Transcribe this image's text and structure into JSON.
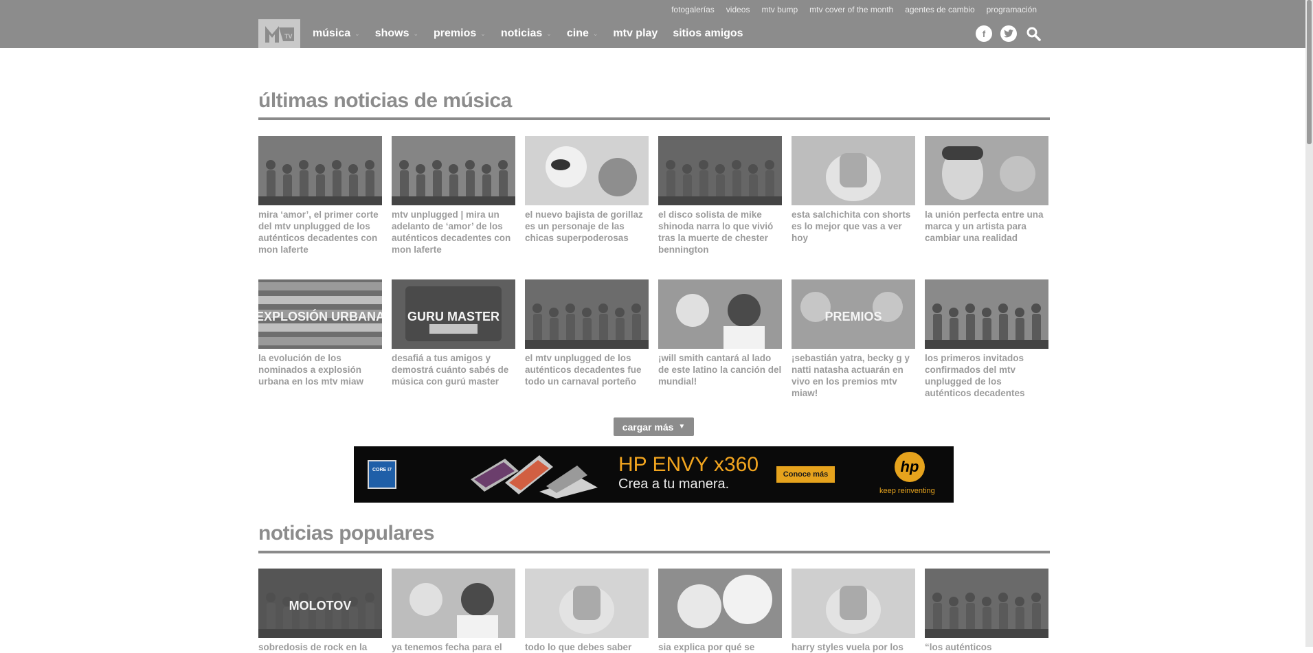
{
  "top_links": [
    "fotogalerías",
    "videos",
    "mtv bump",
    "mtv cover of the month",
    "agentes de cambio",
    "programación"
  ],
  "nav": [
    {
      "label": "música",
      "dropdown": true
    },
    {
      "label": "shows",
      "dropdown": true
    },
    {
      "label": "premios",
      "dropdown": true
    },
    {
      "label": "noticias",
      "dropdown": true
    },
    {
      "label": "cine",
      "dropdown": true
    },
    {
      "label": "mtv play",
      "dropdown": false
    },
    {
      "label": "sitios amigos",
      "dropdown": false
    }
  ],
  "social": {
    "facebook": "f"
  },
  "latest": {
    "title": "últimas noticias de música",
    "items": [
      {
        "caption": "mira ‘amor’, el primer corte del mtv unplugged de los auténticos decadentes con mon laferte",
        "thumb": "concert",
        "tone": "#7a7a7a"
      },
      {
        "caption": "mtv unplugged | mira un adelanto de ‘amor’ de los auténticos decadentes con mon laferte",
        "thumb": "concert",
        "tone": "#858585"
      },
      {
        "caption": "el nuevo bajista de gorillaz es un personaje de las chicas superpoderosas",
        "thumb": "cartoon",
        "tone": "#d2d2d2"
      },
      {
        "caption": "el disco solista de mike shinoda narra lo que vivió tras la muerte de chester bennington",
        "thumb": "stage",
        "tone": "#666666"
      },
      {
        "caption": "esta salchichita con shorts es lo mejor que vas a ver hoy",
        "thumb": "light",
        "tone": "#bdbdbd"
      },
      {
        "caption": "la unión perfecta entre una marca y un artista para cambiar una realidad",
        "thumb": "portrait",
        "tone": "#a8a8a8"
      },
      {
        "caption": "la evolución de los nominados a explosión urbana en los mtv miaw",
        "thumb": "text-bitch",
        "tone": "#6e6e6e",
        "overlay": "EXPLOSIÓN URBANA"
      },
      {
        "caption": "desafiá a tus amigos y demostrá cuánto sabés de música con gurú master",
        "thumb": "guru",
        "tone": "#5f5f5f",
        "overlay": "GURU MASTER"
      },
      {
        "caption": "el mtv unplugged de los auténticos decadentes fue todo un carnaval porteño",
        "thumb": "concert",
        "tone": "#6c6c6c"
      },
      {
        "caption": "¡will smith cantará al lado de este latino la canción del mundial!",
        "thumb": "people",
        "tone": "#9a9a9a"
      },
      {
        "caption": "¡sebastián yatra, becky g y natti natasha actuarán en vivo en los premios mtv miaw!",
        "thumb": "premios",
        "tone": "#a0a0a0",
        "overlay": "PREMIOS"
      },
      {
        "caption": "los primeros invitados confirmados del mtv unplugged de los auténticos decadentes",
        "thumb": "group",
        "tone": "#8a8a8a"
      }
    ]
  },
  "load_more": {
    "label": "cargar más"
  },
  "ad": {
    "title": "HP ENVY x360",
    "subtitle": "Crea a tu manera.",
    "button": "Conoce más",
    "tagline": "keep reinventing",
    "logo": "hp",
    "intel": "CORE i7"
  },
  "popular": {
    "title": "noticias populares",
    "items": [
      {
        "caption": "sobredosis de rock en la",
        "thumb": "molotov",
        "tone": "#555555",
        "overlay": "MOLOTOV"
      },
      {
        "caption": "ya tenemos fecha para el",
        "thumb": "people",
        "tone": "#bdbdbd"
      },
      {
        "caption": "todo lo que debes saber",
        "thumb": "light",
        "tone": "#d4d4d4"
      },
      {
        "caption": "sia explica por qué se",
        "thumb": "sia",
        "tone": "#8e8e8e"
      },
      {
        "caption": "harry styles vuela por los",
        "thumb": "light",
        "tone": "#cfcfcf"
      },
      {
        "caption": "“los auténticos",
        "thumb": "group",
        "tone": "#6a6a6a"
      }
    ]
  }
}
